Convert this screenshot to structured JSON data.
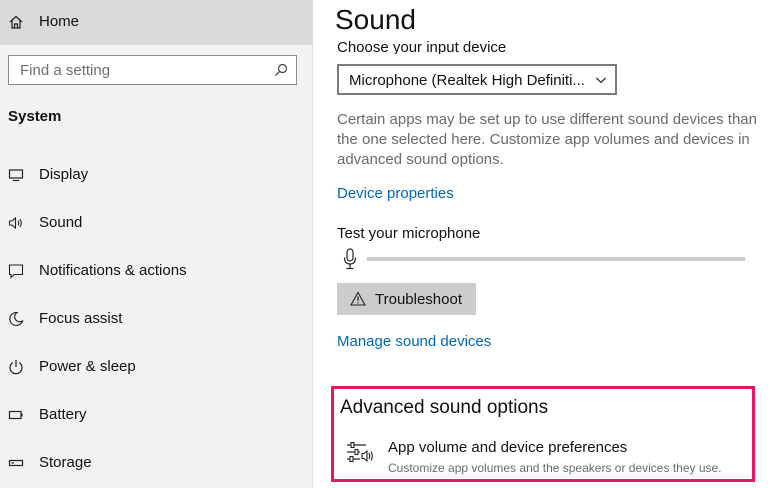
{
  "sidebar": {
    "home_label": "Home",
    "search_placeholder": "Find a setting",
    "section_label": "System",
    "items": [
      {
        "label": "Display",
        "icon": "monitor-icon"
      },
      {
        "label": "Sound",
        "icon": "speaker-icon"
      },
      {
        "label": "Notifications & actions",
        "icon": "notification-icon"
      },
      {
        "label": "Focus assist",
        "icon": "moon-icon"
      },
      {
        "label": "Power & sleep",
        "icon": "power-icon"
      },
      {
        "label": "Battery",
        "icon": "battery-icon"
      },
      {
        "label": "Storage",
        "icon": "storage-icon"
      }
    ]
  },
  "main": {
    "title": "Sound",
    "input_heading": "Choose your input device",
    "input_device": "Microphone (Realtek High Definiti...",
    "description": "Certain apps may be set up to use different sound devices than the one selected here. Customize app volumes and devices in advanced sound options.",
    "device_properties_link": "Device properties",
    "test_mic_label": "Test your microphone",
    "mic_level_percent": 0,
    "troubleshoot_label": "Troubleshoot",
    "manage_devices_link": "Manage sound devices",
    "advanced": {
      "title": "Advanced sound options",
      "pref_title": "App volume and device preferences",
      "pref_description": "Customize app volumes and the speakers or devices they use."
    }
  },
  "colors": {
    "accent": "#0067b8",
    "highlight_border": "#e8195a",
    "sidebar_bg": "#f2f2f2",
    "home_bg": "#dadada"
  }
}
